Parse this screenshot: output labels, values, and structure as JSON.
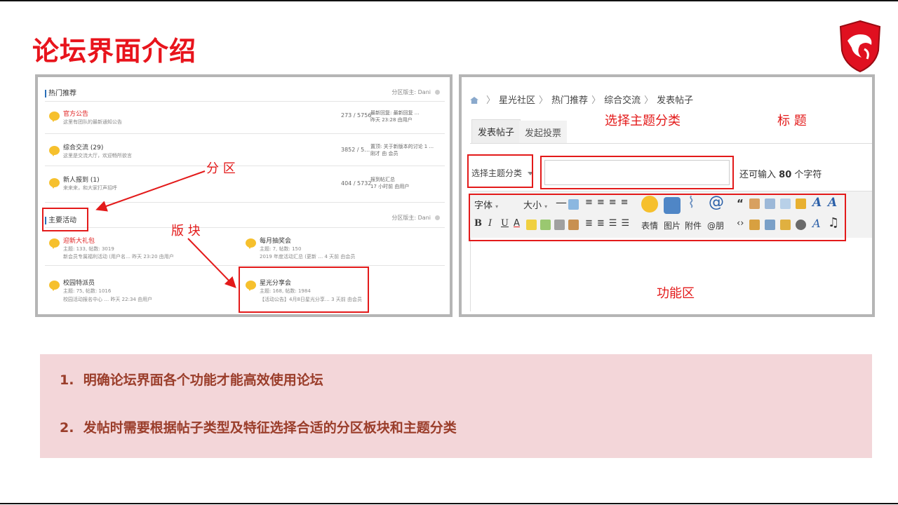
{
  "slide": {
    "title": "论坛界面介绍",
    "accent_color": "#e8141c"
  },
  "forum_list": {
    "hot_section": {
      "title": "热门推荐",
      "moderator": "分区版主: Dani",
      "forums": [
        {
          "name": "官方公告",
          "desc": "这里有团队的最新通知公告",
          "stats": "273 / 5756",
          "last": [
            "最新回复: 最新回复 ...",
            "昨天 23:28 由用户"
          ]
        },
        {
          "name": "综合交流 (29)",
          "desc": "这里是交流大厅，欢迎畅所欲言",
          "stats": "3852 / 5…",
          "last": [
            "置顶: 关于新版本的讨论 1 ...",
            "刚才 由 会员"
          ]
        },
        {
          "name": "新人报到 (1)",
          "desc": "来来来，和大家打声招呼",
          "stats": "404 / 5732",
          "last": [
            "报到帖汇总",
            "17 小时前 由用户"
          ]
        }
      ]
    },
    "main_section": {
      "title": "主要活动",
      "moderator": "分区版主: Dani",
      "forums": [
        {
          "name": "迎新大礼包",
          "desc": "主题: 133, 帖数: 3019",
          "last": "新会员专属福利活动 (用户名… 昨天 23:20 由用户"
        },
        {
          "name": "每月抽奖会",
          "desc": "主题: 7, 帖数: 150",
          "last": "2019 年度活动汇总 (更新 … 4 天前 由会员"
        },
        {
          "name": "校园特派员",
          "desc": "主题: 75, 帖数: 1016",
          "last": "校园活动报名中心 … 昨天 22:34 由用户"
        },
        {
          "name": "星光分享会",
          "desc": "主题: 168, 帖数: 1984",
          "last": "【活动公告】4月8日星光分享… 3 天前 由会员"
        }
      ]
    },
    "annotations": {
      "section": "分 区",
      "board": "版 块"
    }
  },
  "post_editor": {
    "breadcrumb": [
      "星光社区",
      "热门推荐",
      "综合交流",
      "发表帖子"
    ],
    "tabs": [
      "发表帖子",
      "发起投票"
    ],
    "category_select": "选择主题分类",
    "title_input": "",
    "remaining": {
      "prefix": "还可输入",
      "count": "80",
      "suffix": "个字符"
    },
    "toolbar": {
      "font": "字体",
      "size": "大小",
      "labels": [
        "表情",
        "图片",
        "附件",
        "@朋"
      ]
    },
    "annotations": {
      "category": "选择主题分类",
      "title": "标 题",
      "functions": "功能区"
    }
  },
  "points": [
    {
      "num": "1.",
      "text": "明确论坛界面各个功能才能高效使用论坛"
    },
    {
      "num": "2.",
      "text": "发帖时需要根据帖子类型及特征选择合适的分区板块和主题分类"
    }
  ]
}
